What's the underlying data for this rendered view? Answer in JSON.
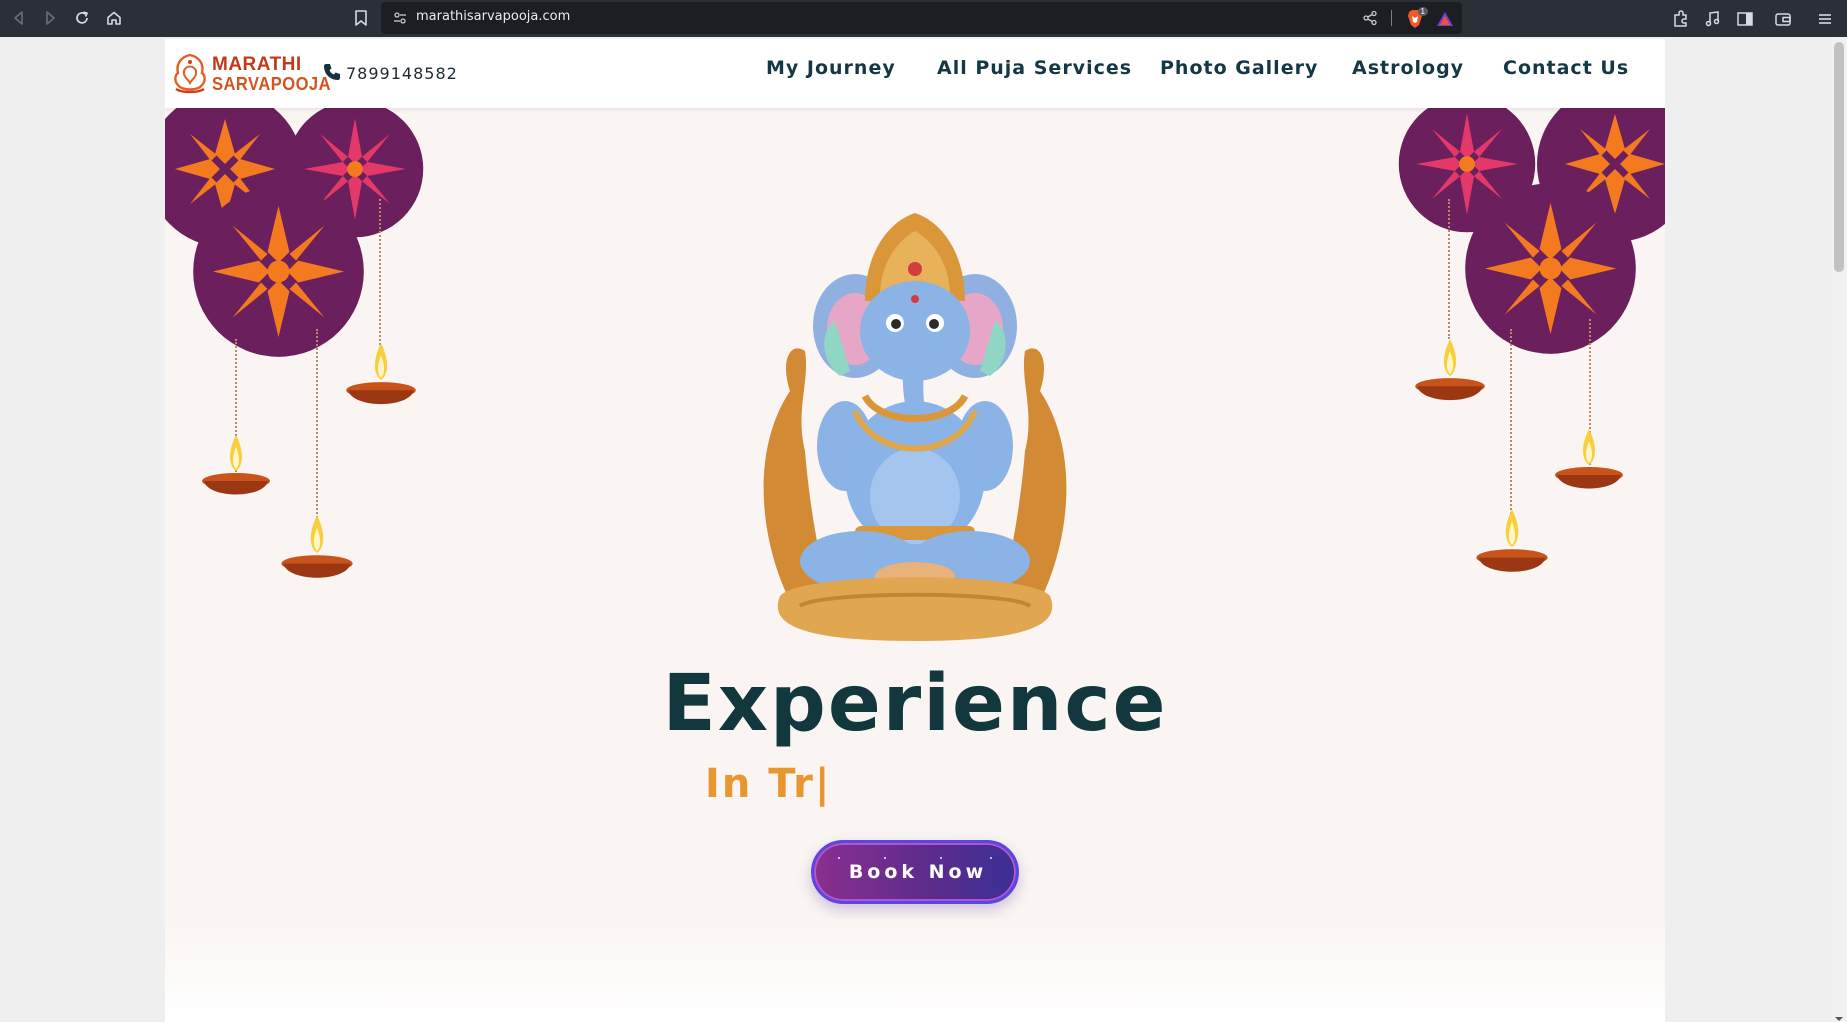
{
  "browser": {
    "url": "marathisarvapooja.com",
    "shield_count": "1"
  },
  "header": {
    "logo": {
      "line1": "MARATHI",
      "line2": "SARVAPOOJA"
    },
    "phone": "7899148582",
    "nav": [
      {
        "label": "My Journey"
      },
      {
        "label": "All Puja Services"
      },
      {
        "label": "Photo Gallery"
      },
      {
        "label": "Astrology"
      },
      {
        "label": "Contact Us"
      }
    ]
  },
  "hero": {
    "title": "Experience",
    "subtitle": "In Tr|",
    "cta_label": "Book Now"
  },
  "colors": {
    "title": "#12383e",
    "subtitle": "#e8962f",
    "nav_text": "#143744",
    "cta_start": "#8a2f8f",
    "cta_end": "#3b2f96",
    "rangoli": "#6b1f5c",
    "rangoli_petal": "#f47a20"
  },
  "icons": [
    "back-icon",
    "forward-icon",
    "reload-icon",
    "home-icon",
    "bookmark-icon",
    "site-info-icon",
    "share-icon",
    "brave-shield-icon",
    "rewards-icon",
    "extensions-icon",
    "media-icon",
    "sidebar-icon",
    "wallet-icon",
    "menu-icon",
    "phone-icon"
  ]
}
